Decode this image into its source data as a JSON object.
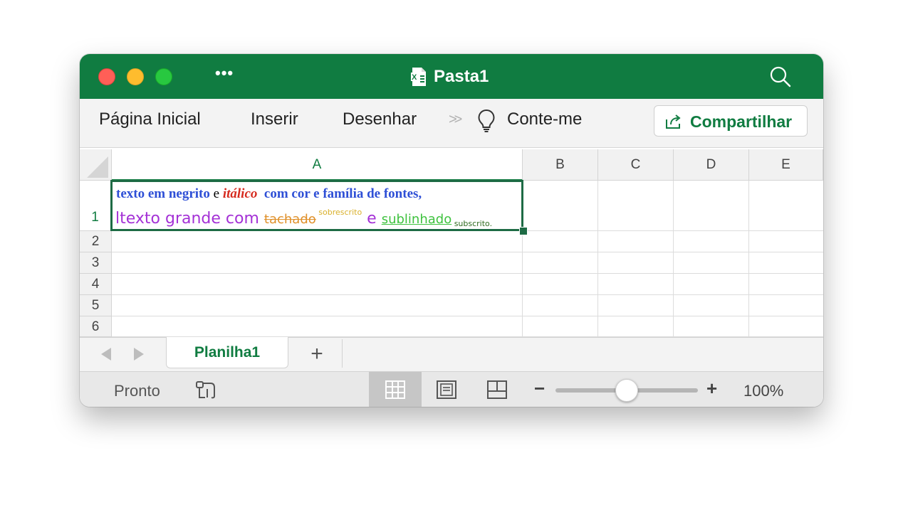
{
  "window": {
    "title": "Pasta1",
    "title_icon": "excel-file-icon",
    "more_label": "•••",
    "colors": {
      "titlebar": "#107c41",
      "accent": "#107c41",
      "selection": "#1e6b45"
    }
  },
  "ribbon": {
    "tabs": [
      "Página Inicial",
      "Inserir",
      "Desenhar"
    ],
    "overflow_label": ">>",
    "tell_me": "Conte-me",
    "share_label": "Compartilhar"
  },
  "grid": {
    "columns": [
      "A",
      "B",
      "C",
      "D",
      "E"
    ],
    "rows": [
      "1",
      "2",
      "3",
      "4",
      "5",
      "6"
    ],
    "selected_cell": "A1",
    "cell_a1": {
      "line1": [
        {
          "text": "texto em negrito",
          "color": "#2e4fd6",
          "style": "bold"
        },
        {
          "text": " e ",
          "color": "#000000",
          "style": "normal"
        },
        {
          "text": "itálico",
          "color": "#d62b1f",
          "style": "bold-italic"
        },
        {
          "text": "  com cor e família de fontes,",
          "color": "#2e4fd6",
          "style": "bold"
        }
      ],
      "line2": [
        {
          "text": "ltexto grande com ",
          "color": "#a431d6",
          "style": "large"
        },
        {
          "text": "tachado",
          "color": "#e0912b",
          "style": "strike"
        },
        {
          "text": " sobrescrito",
          "color": "#d9b02a",
          "style": "sup"
        },
        {
          "text": " e ",
          "color": "#a431d6",
          "style": "large"
        },
        {
          "text": "sublinhado",
          "color": "#3fc23f",
          "style": "underline"
        },
        {
          "text": " subscrito.",
          "color": "#2f6b1f",
          "style": "sub"
        }
      ]
    }
  },
  "sheets": {
    "active": "Planilha1",
    "add_label": "+"
  },
  "status": {
    "text": "Pronto",
    "zoom_minus": "−",
    "zoom_plus": "+",
    "zoom_level": "100%",
    "zoom_value": 100
  }
}
